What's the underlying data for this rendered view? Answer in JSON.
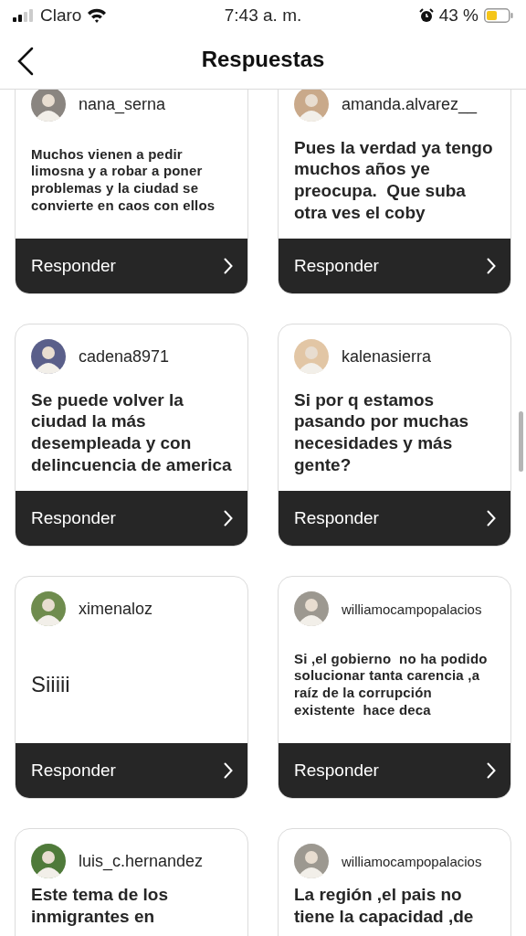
{
  "status_bar": {
    "carrier": "Claro",
    "time": "7:43 a. m.",
    "battery": "43 %"
  },
  "header": {
    "title": "Respuestas"
  },
  "responses": [
    {
      "username": "nana_serna",
      "text": "Muchos vienen a pedir limosna y a robar a poner problemas y la ciudad se convierte en caos con ellos",
      "action": "Responder"
    },
    {
      "username": "amanda.alvarez__",
      "text": "Pues la verdad ya tengo muchos años ye preocupa.  Que suba otra ves el coby",
      "action": "Responder"
    },
    {
      "username": "cadena8971",
      "text": "Se puede volver la ciudad la más desempleada y con delincuencia de america",
      "action": "Responder"
    },
    {
      "username": "kalenasierra",
      "text": "Si por q estamos pasando por muchas necesidades y más gente?",
      "action": "Responder"
    },
    {
      "username": "ximenaloz",
      "text": "Siiiii",
      "action": "Responder"
    },
    {
      "username": "williamocampopalacios",
      "text": "Si ,el gobierno  no ha podido solucionar tanta carencia ,a raíz de la corrupción existente  hace deca",
      "action": "Responder"
    },
    {
      "username": "luis_c.hernandez",
      "text": "Este tema de los inmigrantes en"
    },
    {
      "username": "williamocampopalacios",
      "text": "La región ,el pais no tiene la capacidad ,de"
    }
  ]
}
